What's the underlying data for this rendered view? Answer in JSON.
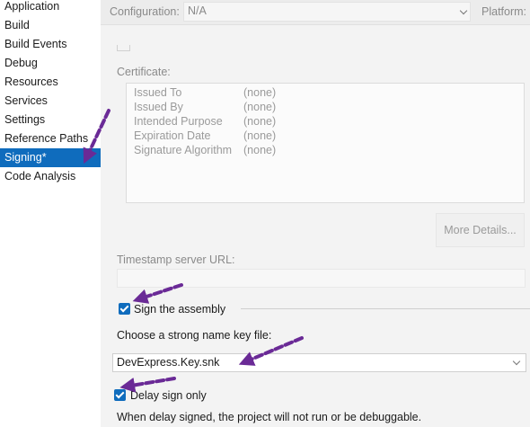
{
  "sidebar": {
    "items": [
      {
        "label": "Application"
      },
      {
        "label": "Build"
      },
      {
        "label": "Build Events"
      },
      {
        "label": "Debug"
      },
      {
        "label": "Resources"
      },
      {
        "label": "Services"
      },
      {
        "label": "Settings"
      },
      {
        "label": "Reference Paths"
      },
      {
        "label": "Signing*"
      },
      {
        "label": "Code Analysis"
      }
    ]
  },
  "toolbar": {
    "configuration_label": "Configuration:",
    "configuration_value": "N/A",
    "platform_label": "Platform:"
  },
  "certificate": {
    "label": "Certificate:",
    "rows": [
      {
        "key": "Issued To",
        "value": "(none)"
      },
      {
        "key": "Issued By",
        "value": "(none)"
      },
      {
        "key": "Intended Purpose",
        "value": "(none)"
      },
      {
        "key": "Expiration Date",
        "value": "(none)"
      },
      {
        "key": "Signature Algorithm",
        "value": "(none)"
      }
    ],
    "more_details": "More Details..."
  },
  "timestamp": {
    "label": "Timestamp server URL:",
    "value": ""
  },
  "signing": {
    "sign_assembly_label": "Sign the assembly",
    "sign_assembly_checked": true,
    "key_file_label": "Choose a strong name key file:",
    "key_file_value": "DevExpress.Key.snk",
    "delay_sign_label": "Delay sign only",
    "delay_sign_checked": true,
    "delay_sign_note": "When delay signed, the project will not run or be debuggable."
  },
  "colors": {
    "accent": "#0f6cbd",
    "annotation_arrow": "#6a2a96"
  }
}
